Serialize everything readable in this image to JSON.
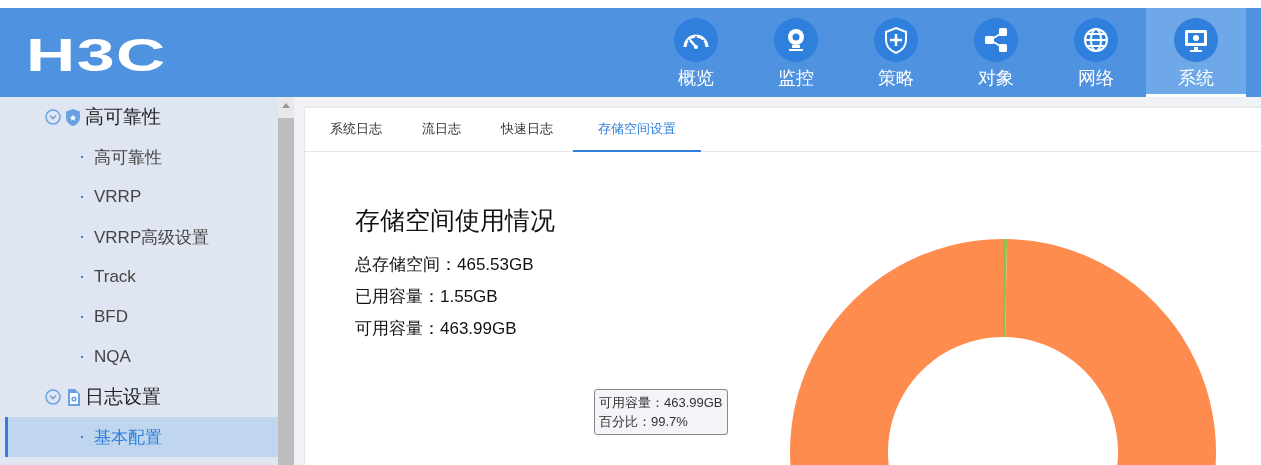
{
  "logo": "H3C",
  "nav": [
    {
      "label": "概览",
      "selected": false
    },
    {
      "label": "监控",
      "selected": false
    },
    {
      "label": "策略",
      "selected": false
    },
    {
      "label": "对象",
      "selected": false
    },
    {
      "label": "网络",
      "selected": false
    },
    {
      "label": "系统",
      "selected": true
    }
  ],
  "sidebar": {
    "items": [
      {
        "label": "高可靠性",
        "expanded": true,
        "children": [
          {
            "label": "高可靠性",
            "selected": false
          },
          {
            "label": "VRRP",
            "selected": false
          },
          {
            "label": "VRRP高级设置",
            "selected": false
          },
          {
            "label": "Track",
            "selected": false
          },
          {
            "label": "BFD",
            "selected": false
          },
          {
            "label": "NQA",
            "selected": false
          }
        ]
      },
      {
        "label": "日志设置",
        "expanded": true,
        "children": [
          {
            "label": "基本配置",
            "selected": true
          }
        ]
      }
    ]
  },
  "tabs": [
    {
      "label": "系统日志",
      "selected": false
    },
    {
      "label": "流日志",
      "selected": false
    },
    {
      "label": "快速日志",
      "selected": false
    },
    {
      "label": "存储空间设置",
      "selected": true
    }
  ],
  "storage": {
    "title": "存储空间使用情况",
    "lines": [
      "总存储空间：465.53GB",
      "已用容量：1.55GB",
      "可用容量：463.99GB"
    ],
    "chart_data": {
      "type": "donut",
      "values": [
        0.3,
        99.7
      ]
    },
    "tooltip": {
      "lines": [
        "可用容量：463.99GB",
        "百分比：99.7%"
      ]
    }
  }
}
